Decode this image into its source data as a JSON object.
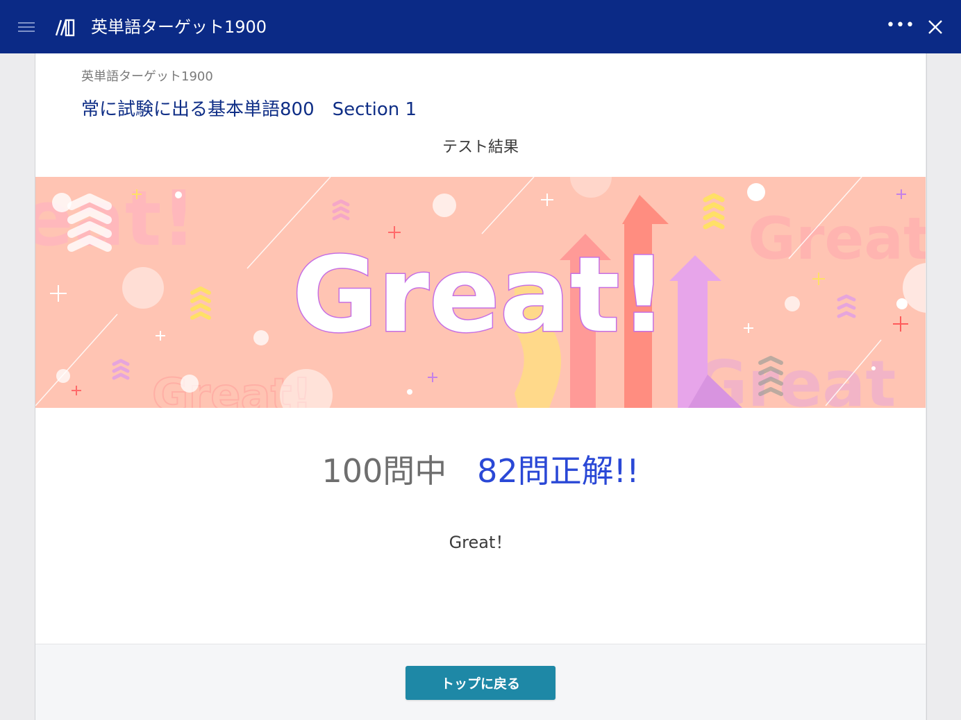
{
  "window": {
    "title": "英単語ターゲット1900",
    "menu_icon": "hamburger-menu-icon",
    "logo_icon": "book-logo-icon",
    "more_icon": "more-options-icon",
    "close_icon": "close-icon",
    "more_label": "•••"
  },
  "header": {
    "breadcrumb": "英単語ターゲット1900",
    "section_title": "常に試験に出る基本単語800　Section 1",
    "page_heading": "テスト結果"
  },
  "banner": {
    "headline": "Great!",
    "background_words": [
      "eat!",
      "Great",
      "Great",
      "Great!"
    ]
  },
  "result": {
    "total_text": "100問中",
    "correct_text": "82問正解!!",
    "total_questions": 100,
    "correct_answers": 82,
    "message": "Great！"
  },
  "footer": {
    "back_button_label": "トップに戻る"
  },
  "colors": {
    "titlebar": "#0b2a86",
    "section_title": "#0f2e86",
    "correct_count": "#2a48d6",
    "button": "#1e88a6",
    "banner_bg": "#ffc4b3"
  }
}
